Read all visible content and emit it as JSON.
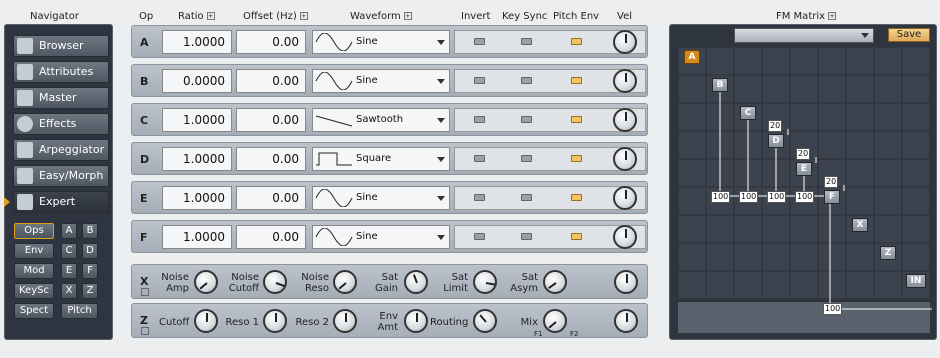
{
  "navigator": {
    "title": "Navigator",
    "items": [
      {
        "label": "Browser",
        "icon": "browser-icon"
      },
      {
        "label": "Attributes",
        "icon": "attributes-icon"
      },
      {
        "label": "Master",
        "icon": "master-icon"
      },
      {
        "label": "Effects",
        "icon": "effects-icon"
      },
      {
        "label": "Arpeggiator",
        "icon": "arpeggiator-icon"
      },
      {
        "label": "Easy/Morph",
        "icon": "easy-morph-icon"
      },
      {
        "label": "Expert",
        "icon": "expert-icon"
      }
    ],
    "subs": [
      "Ops",
      "A",
      "B",
      "Env",
      "C",
      "D",
      "Mod",
      "E",
      "F",
      "KeySc",
      "X",
      "Z",
      "Spect",
      "Pitch"
    ]
  },
  "headers": {
    "op": "Op",
    "ratio": "Ratio",
    "offset": "Offset (Hz)",
    "waveform": "Waveform",
    "invert": "Invert",
    "keysync": "Key Sync",
    "pitchenv": "Pitch Env",
    "vel": "Vel",
    "plus": "+"
  },
  "operators": [
    {
      "name": "A",
      "ratio": "1.0000",
      "offset": "0.00",
      "waveform": "Sine",
      "pitch_env_on": true
    },
    {
      "name": "B",
      "ratio": "0.0000",
      "offset": "0.00",
      "waveform": "Sine",
      "pitch_env_on": true
    },
    {
      "name": "C",
      "ratio": "1.0000",
      "offset": "0.00",
      "waveform": "Sawtooth",
      "pitch_env_on": true
    },
    {
      "name": "D",
      "ratio": "1.0000",
      "offset": "0.00",
      "waveform": "Square",
      "pitch_env_on": true
    },
    {
      "name": "E",
      "ratio": "1.0000",
      "offset": "0.00",
      "waveform": "Sine",
      "pitch_env_on": true
    },
    {
      "name": "F",
      "ratio": "1.0000",
      "offset": "0.00",
      "waveform": "Sine",
      "pitch_env_on": true
    }
  ],
  "x_row": {
    "name": "X",
    "knobs": [
      "Noise Amp",
      "Noise Cutoff",
      "Noise Reso",
      "Sat Gain",
      "Sat Limit",
      "Sat Asym"
    ]
  },
  "z_row": {
    "name": "Z",
    "knobs": [
      "Cutoff",
      "Reso 1",
      "Reso 2",
      "Env Amt",
      "Routing",
      "Mix"
    ],
    "mix_f1": "F1",
    "mix_f2": "F2"
  },
  "fm_matrix": {
    "title": "FM Matrix",
    "save": "Save",
    "ops": [
      "A",
      "B",
      "C",
      "D",
      "E",
      "F",
      "X",
      "Z",
      "IN"
    ],
    "feedback": [
      "20",
      "20",
      "20"
    ],
    "amounts": [
      "100",
      "100",
      "100",
      "100",
      "100"
    ],
    "output": "100"
  },
  "colors": {
    "accent": "#e0a020",
    "led_on": "#f2c560",
    "panel_dark": "#2f353f"
  }
}
